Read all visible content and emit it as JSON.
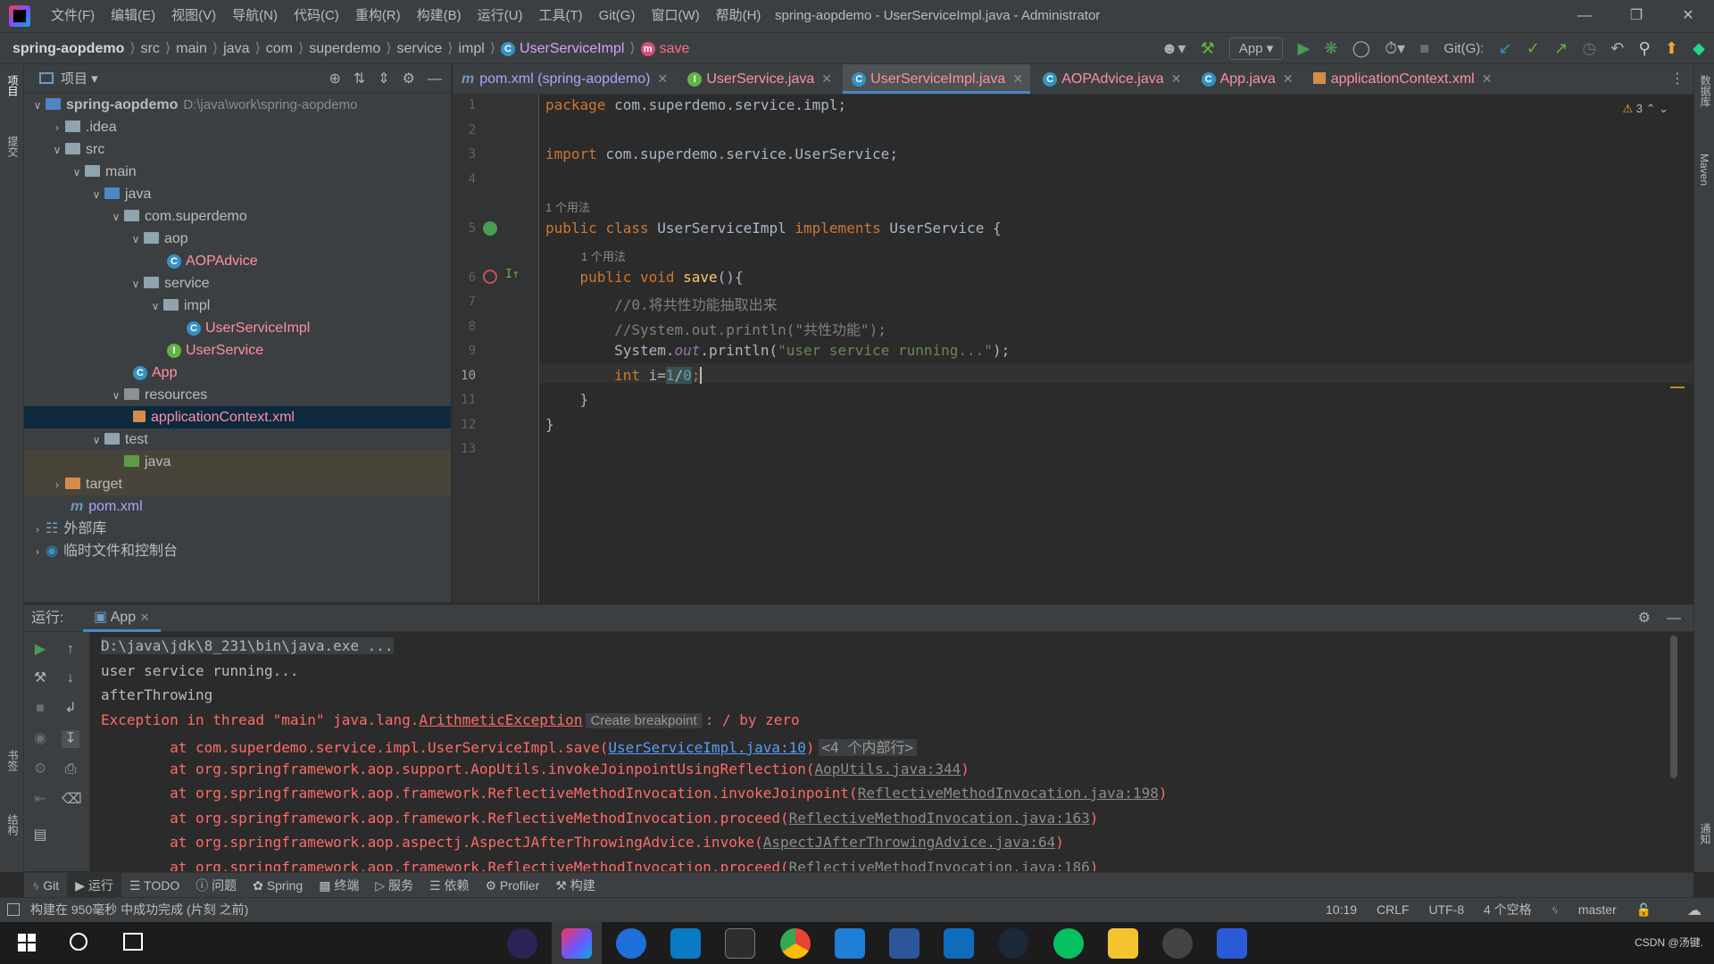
{
  "titlebar": {
    "menu": [
      "文件(F)",
      "编辑(E)",
      "视图(V)",
      "导航(N)",
      "代码(C)",
      "重构(R)",
      "构建(B)",
      "运行(U)",
      "工具(T)",
      "Git(G)",
      "窗口(W)",
      "帮助(H)"
    ],
    "window_title": "spring-aopdemo - UserServiceImpl.java - Administrator"
  },
  "breadcrumb": [
    "spring-aopdemo",
    "src",
    "main",
    "java",
    "com",
    "superdemo",
    "service",
    "impl",
    "UserServiceImpl",
    "save"
  ],
  "toolbar": {
    "run_config": "App",
    "git_label": "Git(G):"
  },
  "left_stripe": {
    "project": "项目",
    "commit": "提交",
    "bookmarks": "书签",
    "structure": "结构"
  },
  "right_stripe": {
    "database": "数据库",
    "maven": "Maven",
    "notifications": "通知"
  },
  "project_panel": {
    "title": "项目",
    "tree": [
      {
        "label": "spring-aopdemo",
        "path": "D:\\java\\work\\spring-aopdemo"
      },
      {
        "label": ".idea"
      },
      {
        "label": "src"
      },
      {
        "label": "main"
      },
      {
        "label": "java"
      },
      {
        "label": "com.superdemo"
      },
      {
        "label": "aop"
      },
      {
        "label": "AOPAdvice"
      },
      {
        "label": "service"
      },
      {
        "label": "impl"
      },
      {
        "label": "UserServiceImpl"
      },
      {
        "label": "UserService"
      },
      {
        "label": "App"
      },
      {
        "label": "resources"
      },
      {
        "label": "applicationContext.xml"
      },
      {
        "label": "test"
      },
      {
        "label": "java"
      },
      {
        "label": "target"
      },
      {
        "label": "pom.xml"
      },
      {
        "label": "外部库"
      },
      {
        "label": "临时文件和控制台"
      }
    ]
  },
  "tabs": [
    {
      "label": "pom.xml (spring-aopdemo)"
    },
    {
      "label": "UserService.java"
    },
    {
      "label": "UserServiceImpl.java"
    },
    {
      "label": "AOPAdvice.java"
    },
    {
      "label": "App.java"
    },
    {
      "label": "applicationContext.xml"
    }
  ],
  "editor": {
    "warnings": "3",
    "usage_hint": "1 个用法",
    "lines": {
      "l1": [
        "package",
        " com.superdemo.service.impl;"
      ],
      "l3": [
        "import",
        " com.superdemo.service.UserService;"
      ],
      "l5": [
        "public",
        "class",
        "UserServiceImpl",
        "implements",
        "UserService {"
      ],
      "l6": [
        "public",
        "void",
        "save",
        "(){"
      ],
      "l7": "//0.将共性功能抽取出来",
      "l8": "//System.out.println(\"共性功能\");",
      "l9": [
        "System.",
        "out",
        ".println(",
        "\"user service running...\"",
        ");"
      ],
      "l10": [
        "int",
        " i=",
        "1",
        "/",
        "0",
        ";"
      ],
      "l11": "}",
      "l12": "}"
    },
    "line_numbers": [
      "1",
      "2",
      "3",
      "4",
      "5",
      "6",
      "7",
      "8",
      "9",
      "10",
      "11",
      "12",
      "13"
    ]
  },
  "run_panel": {
    "label": "运行:",
    "tab": "App",
    "console": {
      "cmd": "D:\\java\\jdk\\8_231\\bin\\java.exe ...",
      "out1": "user service running...",
      "out2": "afterThrowing",
      "exc_prefix": "Exception in thread \"main\" java.lang.",
      "exc_class": "ArithmeticException",
      "create_bp": "Create breakpoint",
      "exc_suffix": ": / by zero",
      "traces": [
        {
          "at": "\tat com.superdemo.service.impl.UserServiceImpl.save(",
          "link": "UserServiceImpl.java:10",
          "end": ")",
          "badge": "<4 个内部行>"
        },
        {
          "at": "\tat org.springframework.aop.support.AopUtils.invokeJoinpointUsingReflection(",
          "link": "AopUtils.java:344",
          "end": ")"
        },
        {
          "at": "\tat org.springframework.aop.framework.ReflectiveMethodInvocation.invokeJoinpoint(",
          "link": "ReflectiveMethodInvocation.java:198",
          "end": ")"
        },
        {
          "at": "\tat org.springframework.aop.framework.ReflectiveMethodInvocation.proceed(",
          "link": "ReflectiveMethodInvocation.java:163",
          "end": ")"
        },
        {
          "at": "\tat org.springframework.aop.aspectj.AspectJAfterThrowingAdvice.invoke(",
          "link": "AspectJAfterThrowingAdvice.java:64",
          "end": ")"
        },
        {
          "at": "\tat org.springframework.aop.framework.ReflectiveMethodInvocation.proceed(",
          "link": "ReflectiveMethodInvocation.java:186",
          "end": ")"
        }
      ]
    }
  },
  "bottom_tabs": [
    "Git",
    "运行",
    "TODO",
    "问题",
    "Spring",
    "终端",
    "服务",
    "依赖",
    "Profiler",
    "构建"
  ],
  "status": {
    "message": "构建在 950毫秒 中成功完成 (片刻 之前)",
    "position": "10:19",
    "line_sep": "CRLF",
    "encoding": "UTF-8",
    "indent": "4 个空格",
    "branch": "master"
  },
  "taskbar": {
    "tray_text": "CSDN @汤键."
  },
  "colors": {
    "keyword": "#cc7832",
    "string": "#6a8759",
    "comment": "#808080",
    "error": "#ff6b68",
    "accent": "#4a88c7"
  }
}
